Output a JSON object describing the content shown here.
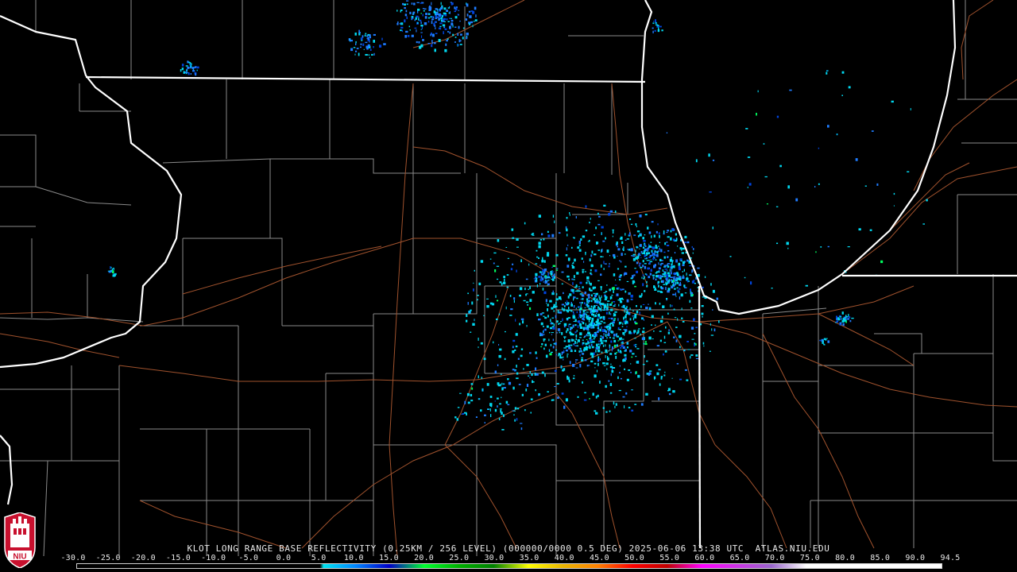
{
  "product": {
    "caption": "KLOT LONG RANGE BASE REFLECTIVITY (0.25KM / 256 LEVEL) (000000/0000 0.5 DEG) 2025-06-06 13:38 UTC  ATLAS.NIU.EDU"
  },
  "logo": {
    "text": "NIU",
    "icon": "niu-logo-icon"
  },
  "colorbar": {
    "ticks": [
      "-30.0",
      "-25.0",
      "-20.0",
      "-15.0",
      "-10.0",
      "-5.0",
      "0.0",
      "5.0",
      "10.0",
      "15.0",
      "20.0",
      "25.0",
      "30.0",
      "35.0",
      "40.0",
      "45.0",
      "50.0",
      "55.0",
      "60.0",
      "65.0",
      "70.0",
      "75.0",
      "80.0",
      "85.0",
      "90.0",
      "94.5"
    ],
    "stops": [
      {
        "value": -30,
        "color": "#000000"
      },
      {
        "value": 5,
        "color": "#000000"
      },
      {
        "value": 5.5,
        "color": "#00e4f0"
      },
      {
        "value": 10,
        "color": "#0088ff"
      },
      {
        "value": 15,
        "color": "#0000c8"
      },
      {
        "value": 20,
        "color": "#00ff30"
      },
      {
        "value": 25,
        "color": "#00b000"
      },
      {
        "value": 30,
        "color": "#008000"
      },
      {
        "value": 35,
        "color": "#ffff00"
      },
      {
        "value": 40,
        "color": "#e8b400"
      },
      {
        "value": 45,
        "color": "#ff8000"
      },
      {
        "value": 50,
        "color": "#ff0000"
      },
      {
        "value": 55,
        "color": "#c00000"
      },
      {
        "value": 60,
        "color": "#ff00ff"
      },
      {
        "value": 70,
        "color": "#9966cc"
      },
      {
        "value": 75,
        "color": "#ffffff"
      },
      {
        "value": 94.5,
        "color": "#ffffff"
      }
    ]
  },
  "colors": {
    "state_border": "#ffffff",
    "county_border": "#8a8a8a",
    "highway": "#a0522d",
    "echo_light": "#00d8f0",
    "echo_mid": "#1e7cff",
    "echo_strong": "#0044dd",
    "background": "#000000"
  }
}
